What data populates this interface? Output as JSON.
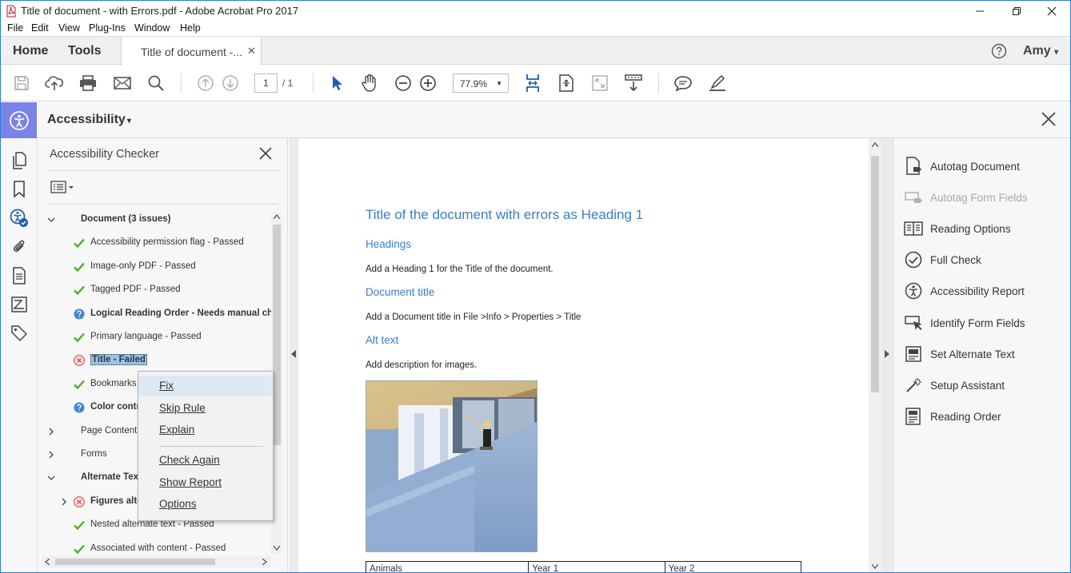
{
  "window": {
    "title": "Title of document - with Errors.pdf - Adobe Acrobat Pro 2017"
  },
  "menu": [
    "File",
    "Edit",
    "View",
    "Plug-Ins",
    "Window",
    "Help"
  ],
  "tabs": {
    "home": "Home",
    "tools": "Tools",
    "document": "Title of document -...",
    "user": "Amy"
  },
  "toolbar": {
    "page_current": "1",
    "page_total": "/ 1",
    "zoom": "77.9%"
  },
  "accessibility_bar": {
    "title": "Accessibility"
  },
  "checker": {
    "title": "Accessibility Checker",
    "rows": [
      {
        "label": "Document (3 issues)",
        "status": "none",
        "bold": true,
        "expander": "expanded",
        "level": 0
      },
      {
        "label": "Accessibility permission flag - Passed",
        "status": "passed",
        "bold": false,
        "level": 1
      },
      {
        "label": "Image-only PDF - Passed",
        "status": "passed",
        "bold": false,
        "level": 1
      },
      {
        "label": "Tagged PDF - Passed",
        "status": "passed",
        "bold": false,
        "level": 1
      },
      {
        "label": "Logical Reading Order - Needs manual check",
        "status": "manual",
        "bold": true,
        "level": 1
      },
      {
        "label": "Primary language - Passed",
        "status": "passed",
        "bold": false,
        "level": 1
      },
      {
        "label": "Title - Failed",
        "status": "failed",
        "bold": true,
        "selected": true,
        "level": 1
      },
      {
        "label": "Bookmarks - Passed",
        "status": "passed",
        "bold": false,
        "level": 1
      },
      {
        "label": "Color contrast - Needs manual check",
        "status": "manual",
        "bold": true,
        "level": 1
      },
      {
        "label": "Page Content",
        "status": "none",
        "bold": false,
        "expander": "collapsed",
        "level": 0
      },
      {
        "label": "Forms",
        "status": "none",
        "bold": false,
        "expander": "collapsed",
        "level": 0
      },
      {
        "label": "Alternate Text",
        "status": "none",
        "bold": true,
        "expander": "expanded",
        "level": 0
      },
      {
        "label": "Figures alternate text - Failed",
        "status": "failed",
        "bold": true,
        "expander": "collapsed",
        "level": 1
      },
      {
        "label": "Nested alternate text - Passed",
        "status": "passed",
        "bold": false,
        "level": 1
      },
      {
        "label": "Associated with content - Passed",
        "status": "passed",
        "bold": false,
        "level": 1
      }
    ]
  },
  "context_menu": {
    "fix": "Fix",
    "skip": "Skip Rule",
    "explain": "Explain",
    "check_again": "Check Again",
    "show_report": "Show Report",
    "options": "Options"
  },
  "document": {
    "heading1": "Title of the document with errors as Heading 1",
    "sections": [
      {
        "heading": "Headings",
        "text": "Add a Heading 1 for the Title of the document."
      },
      {
        "heading": "Document title",
        "text": "Add a Document title in File >Info > Properties > Title"
      },
      {
        "heading": "Alt text",
        "text": "Add description for images."
      }
    ],
    "table_header": [
      "Animals",
      "Year 1",
      "Year 2"
    ]
  },
  "tools_panel": [
    {
      "label": "Autotag Document",
      "icon": "autotag-document-icon",
      "enabled": true
    },
    {
      "label": "Autotag Form Fields",
      "icon": "autotag-form-fields-icon",
      "enabled": false
    },
    {
      "label": "Reading Options",
      "icon": "reading-options-icon",
      "enabled": true
    },
    {
      "label": "Full Check",
      "icon": "full-check-icon",
      "enabled": true
    },
    {
      "label": "Accessibility Report",
      "icon": "accessibility-report-icon",
      "enabled": true
    },
    {
      "label": "Identify Form Fields",
      "icon": "identify-form-fields-icon",
      "enabled": true
    },
    {
      "label": "Set Alternate Text",
      "icon": "set-alternate-text-icon",
      "enabled": true
    },
    {
      "label": "Setup Assistant",
      "icon": "setup-assistant-icon",
      "enabled": true
    },
    {
      "label": "Reading Order",
      "icon": "reading-order-icon",
      "enabled": true
    }
  ],
  "colors": {
    "accent_blue": "#3a7ec6",
    "accessibility_purple": "#7b83e6",
    "passed_green": "#4caf2a",
    "failed_red": "#d9534f",
    "manual_blue": "#3d87d6",
    "selection": "#99c3ec"
  }
}
